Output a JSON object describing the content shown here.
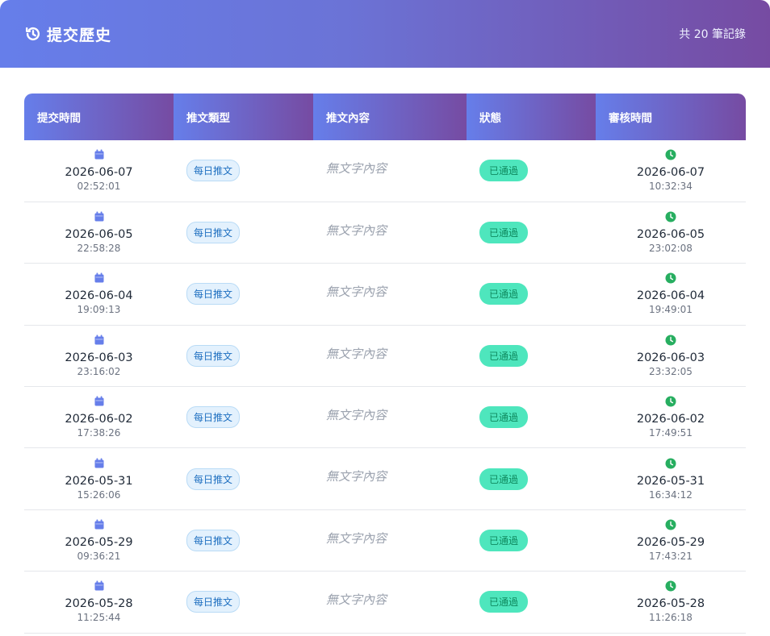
{
  "header": {
    "title": "提交歷史",
    "count_text": "共 20 筆記錄",
    "icon": "history-icon"
  },
  "table": {
    "columns": [
      "提交時間",
      "推文類型",
      "推文內容",
      "狀態",
      "審核時間"
    ],
    "rows": [
      {
        "submit_date": "2026-06-07",
        "submit_time": "02:52:01",
        "type": "每日推文",
        "content": "無文字內容",
        "status": "已通過",
        "review_date": "2026-06-07",
        "review_time": "10:32:34"
      },
      {
        "submit_date": "2026-06-05",
        "submit_time": "22:58:28",
        "type": "每日推文",
        "content": "無文字內容",
        "status": "已通過",
        "review_date": "2026-06-05",
        "review_time": "23:02:08"
      },
      {
        "submit_date": "2026-06-04",
        "submit_time": "19:09:13",
        "type": "每日推文",
        "content": "無文字內容",
        "status": "已通過",
        "review_date": "2026-06-04",
        "review_time": "19:49:01"
      },
      {
        "submit_date": "2026-06-03",
        "submit_time": "23:16:02",
        "type": "每日推文",
        "content": "無文字內容",
        "status": "已通過",
        "review_date": "2026-06-03",
        "review_time": "23:32:05"
      },
      {
        "submit_date": "2026-06-02",
        "submit_time": "17:38:26",
        "type": "每日推文",
        "content": "無文字內容",
        "status": "已通過",
        "review_date": "2026-06-02",
        "review_time": "17:49:51"
      },
      {
        "submit_date": "2026-05-31",
        "submit_time": "15:26:06",
        "type": "每日推文",
        "content": "無文字內容",
        "status": "已通過",
        "review_date": "2026-05-31",
        "review_time": "16:34:12"
      },
      {
        "submit_date": "2026-05-29",
        "submit_time": "09:36:21",
        "type": "每日推文",
        "content": "無文字內容",
        "status": "已通過",
        "review_date": "2026-05-29",
        "review_time": "17:43:21"
      },
      {
        "submit_date": "2026-05-28",
        "submit_time": "11:25:44",
        "type": "每日推文",
        "content": "無文字內容",
        "status": "已通過",
        "review_date": "2026-05-28",
        "review_time": "11:26:18"
      }
    ]
  },
  "colors": {
    "header_gradient_start": "#667eea",
    "header_gradient_end": "#764ba2",
    "calendar_icon": "#667eea",
    "clock_icon": "#27ae60",
    "status_bg": "#4ee6bd",
    "type_badge_bg": "#e3f1fd"
  }
}
